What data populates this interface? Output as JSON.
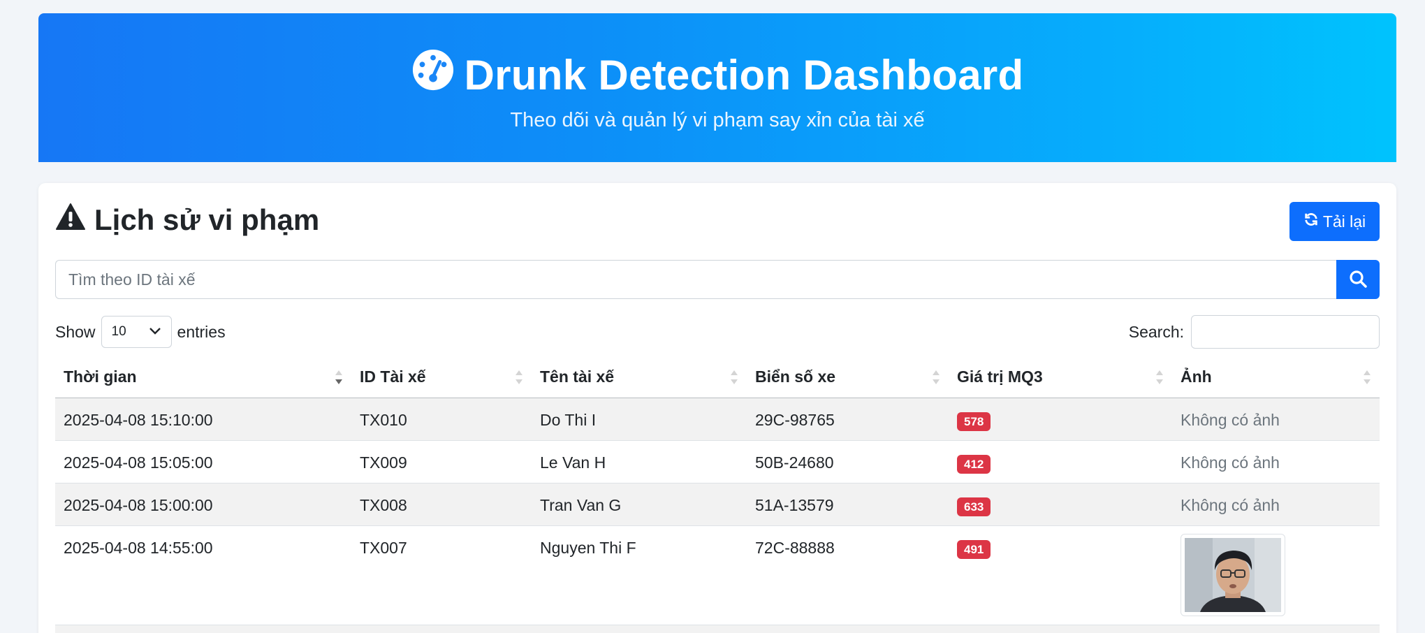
{
  "header": {
    "icon": "gauge-icon",
    "title": "Drunk Detection Dashboard",
    "subtitle": "Theo dõi và quản lý vi phạm say xỉn của tài xế"
  },
  "card": {
    "icon": "warning-triangle-icon",
    "title": "Lịch sử vi phạm",
    "reload_label": "Tải lại",
    "reload_icon": "refresh-icon"
  },
  "driver_search": {
    "placeholder": "Tìm theo ID tài xế",
    "button_icon": "search-icon"
  },
  "table_controls": {
    "show_label": "Show",
    "page_length": "10",
    "entries_label": "entries",
    "search_label": "Search:"
  },
  "table": {
    "columns": [
      "Thời gian",
      "ID Tài xế",
      "Tên tài xế",
      "Biển số xe",
      "Giá trị MQ3",
      "Ảnh"
    ],
    "sorted_column": "Thời gian",
    "sort_direction": "descending",
    "no_image_text": "Không có ảnh",
    "rows": [
      {
        "time": "2025-04-08 15:10:00",
        "id": "TX010",
        "name": "Do Thi I",
        "plate": "29C-98765",
        "mq3": "578",
        "image": "Không có ảnh"
      },
      {
        "time": "2025-04-08 15:05:00",
        "id": "TX009",
        "name": "Le Van H",
        "plate": "50B-24680",
        "mq3": "412",
        "image": "Không có ảnh"
      },
      {
        "time": "2025-04-08 15:00:00",
        "id": "TX008",
        "name": "Tran Van G",
        "plate": "51A-13579",
        "mq3": "633",
        "image": "Không có ảnh"
      },
      {
        "time": "2025-04-08 14:55:00",
        "id": "TX007",
        "name": "Nguyen Thi F",
        "plate": "72C-88888",
        "mq3": "491",
        "image": "driver-photo"
      }
    ]
  },
  "colors": {
    "primary": "#0d6efd",
    "danger_badge": "#dc3545",
    "header_gradient_start": "#1677f5",
    "header_gradient_end": "#00c3fd"
  }
}
